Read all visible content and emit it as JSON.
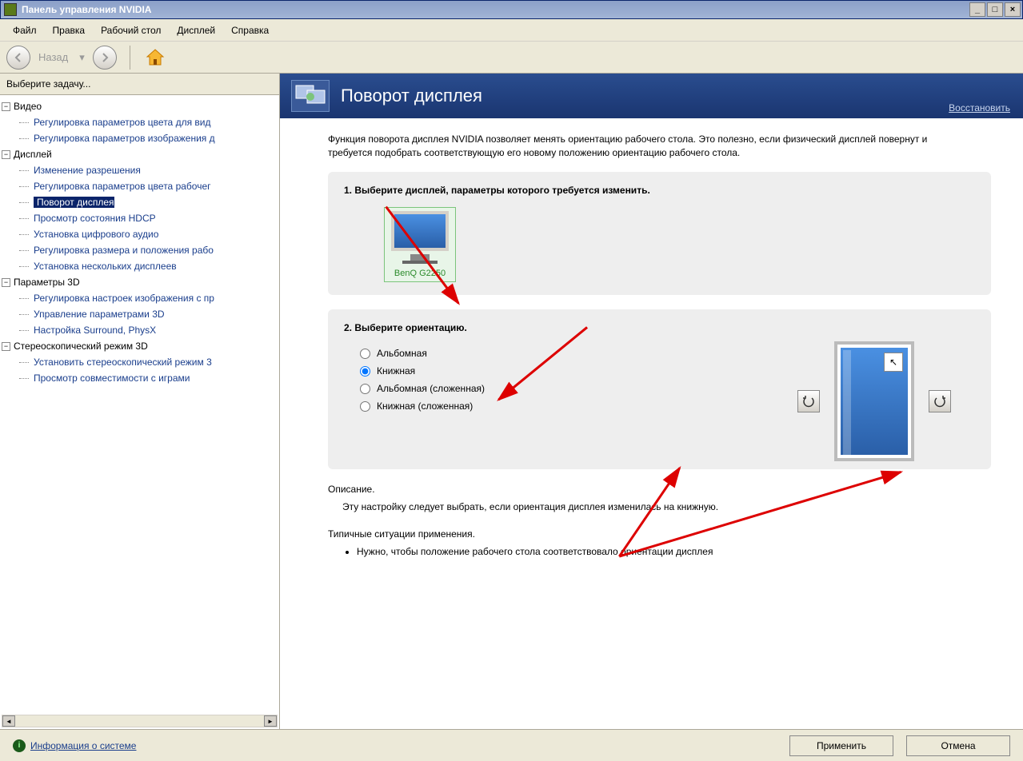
{
  "window": {
    "title": "Панель управления NVIDIA"
  },
  "menu": {
    "file": "Файл",
    "edit": "Правка",
    "desktop": "Рабочий стол",
    "display": "Дисплей",
    "help": "Справка"
  },
  "toolbar": {
    "back": "Назад"
  },
  "sidebar": {
    "header": "Выберите задачу...",
    "cat_video": "Видео",
    "video_1": "Регулировка параметров цвета для вид",
    "video_2": "Регулировка параметров изображения д",
    "cat_display": "Дисплей",
    "disp_1": "Изменение разрешения",
    "disp_2": "Регулировка параметров цвета рабочег",
    "disp_3": "Поворот дисплея",
    "disp_4": "Просмотр состояния HDCP",
    "disp_5": "Установка цифрового аудио",
    "disp_6": "Регулировка размера и положения рабо",
    "disp_7": "Установка нескольких дисплеев",
    "cat_3d": "Параметры 3D",
    "p3d_1": "Регулировка настроек изображения с пр",
    "p3d_2": "Управление параметрами 3D",
    "p3d_3": "Настройка Surround, PhysX",
    "cat_stereo": "Стереоскопический режим 3D",
    "st_1": "Установить стереоскопический режим 3",
    "st_2": "Просмотр совместимости с играми"
  },
  "content": {
    "title": "Поворот дисплея",
    "restore": "Восстановить",
    "intro": "Функция поворота дисплея NVIDIA позволяет менять ориентацию рабочего стола. Это полезно, если физический дисплей повернут и требуется подобрать соответствующую его новому положению ориентацию рабочего стола.",
    "step1": "1. Выберите дисплей, параметры которого требуется изменить.",
    "monitor_name": "BenQ G2250",
    "step2": "2. Выберите ориентацию.",
    "opt1": "Альбомная",
    "opt2": "Книжная",
    "opt3": "Альбомная (сложенная)",
    "opt4": "Книжная (сложенная)",
    "desc_label": "Описание.",
    "desc_body": "Эту настройку следует выбрать, если ориентация дисплея изменилась на книжную.",
    "typical_label": "Типичные ситуации применения.",
    "typical_item": "Нужно, чтобы положение рабочего стола соответствовало ориентации дисплея"
  },
  "footer": {
    "sys_info": "Информация о системе",
    "apply": "Применить",
    "cancel": "Отмена"
  }
}
